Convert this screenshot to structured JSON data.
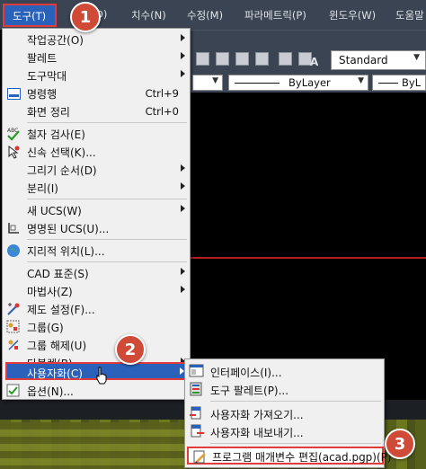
{
  "menubar": {
    "items": [
      {
        "label": "도구(T)"
      },
      {
        "label": "D)"
      },
      {
        "label": "치수(N)"
      },
      {
        "label": "수정(M)"
      },
      {
        "label": "파라메트릭(P)"
      },
      {
        "label": "윈도우(W)"
      },
      {
        "label": "도움말"
      }
    ]
  },
  "toolbar": {
    "text_style_value": "Standard",
    "layer_linetype": "ByLayer",
    "layer_lineweight": "ByL"
  },
  "menu": {
    "items": [
      {
        "label": "작업공간(O)",
        "submenu": true
      },
      {
        "label": "팔레트",
        "submenu": true
      },
      {
        "label": "도구막대",
        "submenu": true
      },
      {
        "label": "명령행",
        "shortcut": "Ctrl+9"
      },
      {
        "label": "화면 정리",
        "shortcut": "Ctrl+0"
      },
      {
        "label": "철자 검사(E)"
      },
      {
        "label": "신속 선택(K)..."
      },
      {
        "label": "그리기 순서(D)",
        "submenu": true
      },
      {
        "label": "분리(I)",
        "submenu": true
      },
      {
        "label": "새 UCS(W)",
        "submenu": true
      },
      {
        "label": "명명된 UCS(U)..."
      },
      {
        "label": "지리적 위치(L)..."
      },
      {
        "label": "CAD 표준(S)",
        "submenu": true
      },
      {
        "label": "마법사(Z)",
        "submenu": true
      },
      {
        "label": "제도 설정(F)..."
      },
      {
        "label": "그룹(G)"
      },
      {
        "label": "그룹 해제(U)"
      },
      {
        "label": "타블렛(B)",
        "submenu": true
      },
      {
        "label": "사용자화(C)",
        "submenu": true
      },
      {
        "label": "옵션(N)..."
      }
    ]
  },
  "submenu": {
    "items": [
      {
        "label": "인터페이스(I)..."
      },
      {
        "label": "도구 팔레트(P)..."
      },
      {
        "label": "사용자화 가져오기..."
      },
      {
        "label": "사용자화 내보내기..."
      },
      {
        "label": "프로그램 매개변수 편집(acad.pgp)(P)"
      }
    ]
  },
  "badges": [
    "1",
    "2",
    "3"
  ],
  "colors": {
    "highlight": "#2a62bb",
    "callout": "#e23b3b",
    "badge": "#d04a38"
  }
}
